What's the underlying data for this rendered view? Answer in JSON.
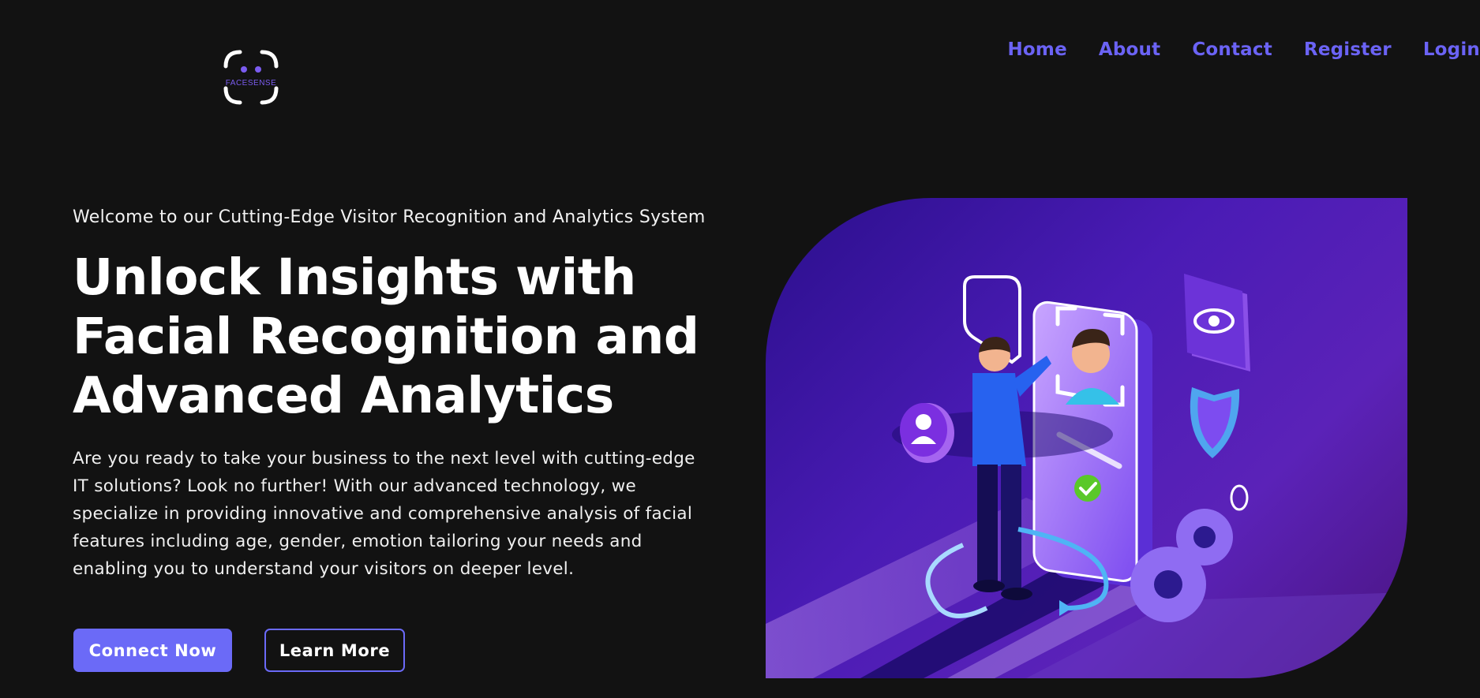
{
  "brand": {
    "name": "FACESENSE"
  },
  "nav": {
    "items": [
      {
        "label": "Home"
      },
      {
        "label": "About"
      },
      {
        "label": "Contact"
      },
      {
        "label": "Register"
      },
      {
        "label": "Login"
      }
    ]
  },
  "hero": {
    "tagline": "Welcome to our Cutting-Edge Visitor Recognition and Analytics System",
    "headline_lines": [
      "Unlock Insights with",
      "Facial Recognition and",
      "Advanced Analytics"
    ],
    "description": "Are you ready to take your business to the next level with cutting-edge IT solutions? Look no further! With our advanced technology, we specialize in providing innovative and comprehensive analysis of facial features including age, gender, emotion tailoring your needs and enabling you to understand your visitors on deeper level.",
    "primary_button": "Connect Now",
    "secondary_button": "Learn More"
  },
  "colors": {
    "background": "#121212",
    "accent": "#6b6af7",
    "text": "#ffffff"
  }
}
